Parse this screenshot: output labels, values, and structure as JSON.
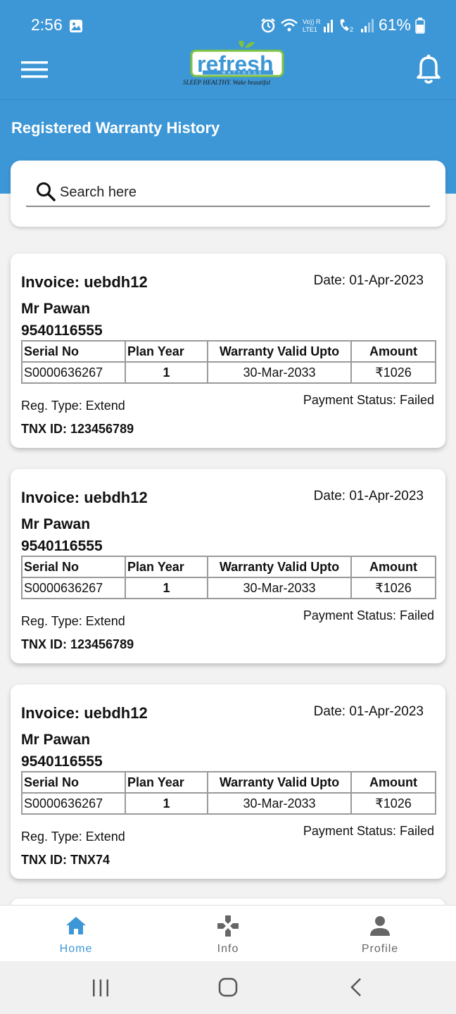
{
  "status_bar": {
    "time": "2:56",
    "battery": "61%",
    "network_label": "Vo)) LTE1",
    "icons": [
      "gallery-icon",
      "alarm-icon",
      "wifi-icon",
      "signal-icon",
      "call-icon",
      "signal-icon",
      "battery-icon"
    ]
  },
  "app_bar": {
    "logo_text": "refresh",
    "logo_subtext": "MATTRESS",
    "logo_tagline": "SLEEP HEALTHY. Wake beautiful",
    "menu_icon": "hamburger-menu-icon",
    "notification_icon": "bell-icon"
  },
  "page": {
    "title": "Registered Warranty History"
  },
  "search": {
    "placeholder": "Search here",
    "icon": "search-icon"
  },
  "table_headers": {
    "serial": "Serial No",
    "plan": "Plan Year",
    "valid": "Warranty Valid Upto",
    "amount": "Amount"
  },
  "records": [
    {
      "invoice": "Invoice: uebdh12",
      "date": "Date: 01-Apr-2023",
      "name": "Mr Pawan",
      "phone": "9540116555",
      "serial": "S0000636267",
      "plan_year": "1",
      "valid_upto": "30-Mar-2033",
      "amount": "₹1026",
      "reg_type": "Reg. Type: Extend",
      "payment_status": "Payment Status: Failed",
      "tnx": "TNX ID: 123456789"
    },
    {
      "invoice": "Invoice: uebdh12",
      "date": "Date: 01-Apr-2023",
      "name": "Mr Pawan",
      "phone": "9540116555",
      "serial": "S0000636267",
      "plan_year": "1",
      "valid_upto": "30-Mar-2033",
      "amount": "₹1026",
      "reg_type": "Reg. Type: Extend",
      "payment_status": "Payment Status: Failed",
      "tnx": "TNX ID: 123456789"
    },
    {
      "invoice": "Invoice: uebdh12",
      "date": "Date: 01-Apr-2023",
      "name": "Mr Pawan",
      "phone": "9540116555",
      "serial": "S0000636267",
      "plan_year": "1",
      "valid_upto": "30-Mar-2033",
      "amount": "₹1026",
      "reg_type": "Reg. Type: Extend",
      "payment_status": "Payment Status: Failed",
      "tnx": "TNX ID: TNX74"
    }
  ],
  "bottom_nav": {
    "items": [
      {
        "label": "Home",
        "icon": "home-icon",
        "active": true
      },
      {
        "label": "Info",
        "icon": "gamepad-icon",
        "active": false
      },
      {
        "label": "Profile",
        "icon": "person-icon",
        "active": false
      }
    ]
  },
  "system_nav": {
    "icons": [
      "recent-apps-icon",
      "home-circle-icon",
      "back-icon"
    ]
  },
  "colors": {
    "primary": "#3d97d6",
    "card_bg": "#ffffff",
    "page_bg": "#f2f2f2",
    "nav_inactive": "#666666"
  }
}
